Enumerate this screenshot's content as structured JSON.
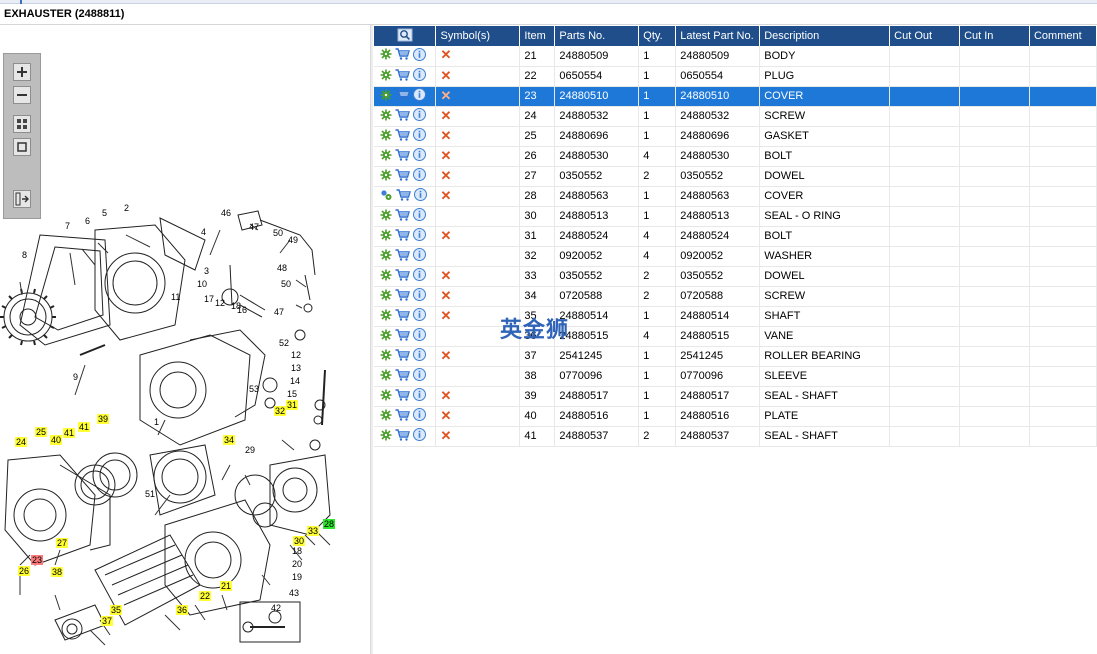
{
  "title": "EXHAUSTER (2488811)",
  "watermark": "英金狮",
  "toolbar": {
    "icons": [
      "zoom-in-icon",
      "zoom-out-icon",
      "fit-page-icon",
      "actual-size-icon",
      "collapse-panel-icon"
    ]
  },
  "drawing": {
    "callouts": [
      {
        "label": "2",
        "style": "plain"
      },
      {
        "label": "4",
        "style": "plain"
      },
      {
        "label": "5",
        "style": "plain"
      },
      {
        "label": "6",
        "style": "plain"
      },
      {
        "label": "7",
        "style": "plain"
      },
      {
        "label": "8",
        "style": "plain"
      },
      {
        "label": "3",
        "style": "plain"
      },
      {
        "label": "10",
        "style": "plain"
      },
      {
        "label": "11",
        "style": "plain"
      },
      {
        "label": "17",
        "style": "plain"
      },
      {
        "label": "12",
        "style": "plain"
      },
      {
        "label": "18",
        "style": "plain"
      },
      {
        "label": "16",
        "style": "plain"
      },
      {
        "label": "46",
        "style": "plain"
      },
      {
        "label": "47",
        "style": "plain"
      },
      {
        "label": "50",
        "style": "plain"
      },
      {
        "label": "49",
        "style": "plain"
      },
      {
        "label": "48",
        "style": "plain"
      },
      {
        "label": "50",
        "style": "plain"
      },
      {
        "label": "47",
        "style": "plain"
      },
      {
        "label": "52",
        "style": "plain"
      },
      {
        "label": "53",
        "style": "plain"
      },
      {
        "label": "12",
        "style": "plain"
      },
      {
        "label": "13",
        "style": "plain"
      },
      {
        "label": "14",
        "style": "plain"
      },
      {
        "label": "15",
        "style": "plain"
      },
      {
        "label": "9",
        "style": "plain"
      },
      {
        "label": "1",
        "style": "plain"
      },
      {
        "label": "29",
        "style": "plain"
      },
      {
        "label": "51",
        "style": "plain"
      },
      {
        "label": "18",
        "style": "plain"
      },
      {
        "label": "20",
        "style": "plain"
      },
      {
        "label": "19",
        "style": "plain"
      },
      {
        "label": "43",
        "style": "plain"
      },
      {
        "label": "42",
        "style": "plain"
      },
      {
        "label": "39",
        "style": "yellow"
      },
      {
        "label": "41",
        "style": "yellow"
      },
      {
        "label": "25",
        "style": "yellow"
      },
      {
        "label": "41",
        "style": "yellow"
      },
      {
        "label": "40",
        "style": "yellow"
      },
      {
        "label": "24",
        "style": "yellow"
      },
      {
        "label": "31",
        "style": "yellow"
      },
      {
        "label": "32",
        "style": "yellow"
      },
      {
        "label": "34",
        "style": "yellow"
      },
      {
        "label": "28",
        "style": "green"
      },
      {
        "label": "33",
        "style": "yellow"
      },
      {
        "label": "30",
        "style": "yellow"
      },
      {
        "label": "27",
        "style": "yellow"
      },
      {
        "label": "23",
        "style": "red"
      },
      {
        "label": "26",
        "style": "yellow"
      },
      {
        "label": "38",
        "style": "yellow"
      },
      {
        "label": "21",
        "style": "yellow"
      },
      {
        "label": "22",
        "style": "yellow"
      },
      {
        "label": "36",
        "style": "yellow"
      },
      {
        "label": "35",
        "style": "yellow"
      },
      {
        "label": "37",
        "style": "yellow"
      }
    ]
  },
  "table": {
    "headers": [
      "",
      "Symbol(s)",
      "Item",
      "Parts No.",
      "Qty.",
      "Latest Part No.",
      "Description",
      "Cut Out",
      "Cut In",
      "Comment"
    ],
    "rows": [
      {
        "item": "21",
        "parts_no": "24880509",
        "qty": "1",
        "latest": "24880509",
        "desc": "BODY",
        "x": true,
        "gear": "single",
        "selected": false
      },
      {
        "item": "22",
        "parts_no": "0650554",
        "qty": "1",
        "latest": "0650554",
        "desc": "PLUG",
        "x": true,
        "gear": "single",
        "selected": false
      },
      {
        "item": "23",
        "parts_no": "24880510",
        "qty": "1",
        "latest": "24880510",
        "desc": "COVER",
        "x": true,
        "gear": "single",
        "selected": true
      },
      {
        "item": "24",
        "parts_no": "24880532",
        "qty": "1",
        "latest": "24880532",
        "desc": "SCREW",
        "x": true,
        "gear": "single",
        "selected": false
      },
      {
        "item": "25",
        "parts_no": "24880696",
        "qty": "1",
        "latest": "24880696",
        "desc": "GASKET",
        "x": true,
        "gear": "single",
        "selected": false
      },
      {
        "item": "26",
        "parts_no": "24880530",
        "qty": "4",
        "latest": "24880530",
        "desc": "BOLT",
        "x": true,
        "gear": "single",
        "selected": false
      },
      {
        "item": "27",
        "parts_no": "0350552",
        "qty": "2",
        "latest": "0350552",
        "desc": "DOWEL",
        "x": true,
        "gear": "single",
        "selected": false
      },
      {
        "item": "28",
        "parts_no": "24880563",
        "qty": "1",
        "latest": "24880563",
        "desc": "COVER",
        "x": true,
        "gear": "double",
        "selected": false
      },
      {
        "item": "30",
        "parts_no": "24880513",
        "qty": "1",
        "latest": "24880513",
        "desc": "SEAL - O RING",
        "x": false,
        "gear": "single",
        "selected": false
      },
      {
        "item": "31",
        "parts_no": "24880524",
        "qty": "4",
        "latest": "24880524",
        "desc": "BOLT",
        "x": true,
        "gear": "single",
        "selected": false
      },
      {
        "item": "32",
        "parts_no": "0920052",
        "qty": "4",
        "latest": "0920052",
        "desc": "WASHER",
        "x": false,
        "gear": "single",
        "selected": false
      },
      {
        "item": "33",
        "parts_no": "0350552",
        "qty": "2",
        "latest": "0350552",
        "desc": "DOWEL",
        "x": true,
        "gear": "single",
        "selected": false
      },
      {
        "item": "34",
        "parts_no": "0720588",
        "qty": "2",
        "latest": "0720588",
        "desc": "SCREW",
        "x": true,
        "gear": "single",
        "selected": false
      },
      {
        "item": "35",
        "parts_no": "24880514",
        "qty": "1",
        "latest": "24880514",
        "desc": "SHAFT",
        "x": true,
        "gear": "single",
        "selected": false
      },
      {
        "item": "36",
        "parts_no": "24880515",
        "qty": "4",
        "latest": "24880515",
        "desc": "VANE",
        "x": false,
        "gear": "single",
        "selected": false
      },
      {
        "item": "37",
        "parts_no": "2541245",
        "qty": "1",
        "latest": "2541245",
        "desc": "ROLLER BEARING",
        "x": true,
        "gear": "single",
        "selected": false
      },
      {
        "item": "38",
        "parts_no": "0770096",
        "qty": "1",
        "latest": "0770096",
        "desc": "SLEEVE",
        "x": false,
        "gear": "single",
        "selected": false
      },
      {
        "item": "39",
        "parts_no": "24880517",
        "qty": "1",
        "latest": "24880517",
        "desc": "SEAL - SHAFT",
        "x": true,
        "gear": "single",
        "selected": false
      },
      {
        "item": "40",
        "parts_no": "24880516",
        "qty": "1",
        "latest": "24880516",
        "desc": "PLATE",
        "x": true,
        "gear": "single",
        "selected": false
      },
      {
        "item": "41",
        "parts_no": "24880537",
        "qty": "2",
        "latest": "24880537",
        "desc": "SEAL - SHAFT",
        "x": true,
        "gear": "single",
        "selected": false
      }
    ]
  },
  "colors": {
    "header": "#1f4e8a",
    "selected": "#1e78d7",
    "x_mark": "#e0531f",
    "gear": "#4a9e2a",
    "cart": "#2f6fd0",
    "info": "#3b7fd6"
  }
}
